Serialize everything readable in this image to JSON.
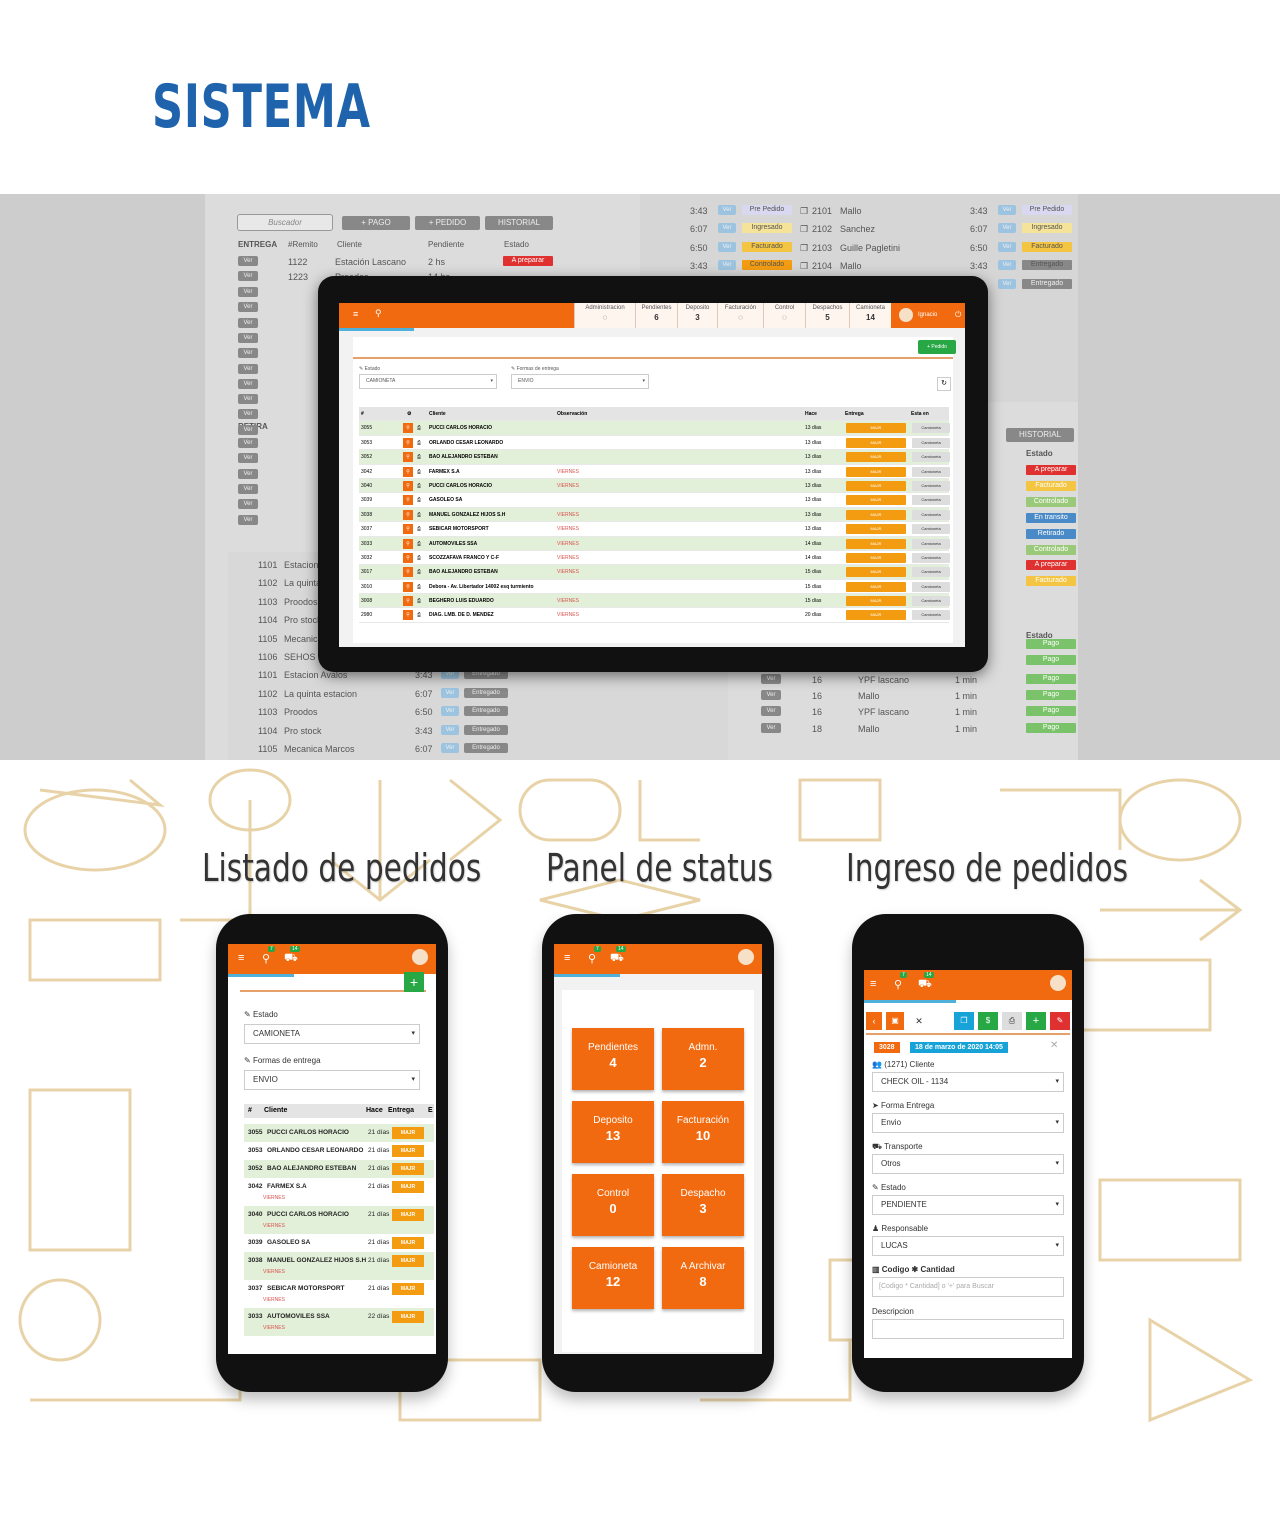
{
  "page": {
    "title": "SISTEMA",
    "sections": [
      {
        "label": "Listado de pedidos"
      },
      {
        "label": "Panel de status"
      },
      {
        "label": "Ingreso de pedidos"
      }
    ]
  },
  "colors": {
    "brand": "#1f63ad",
    "accent": "#f26a0f",
    "badge": "#f39c12",
    "row_green": "#e2f0d9"
  },
  "background_app": {
    "search_placeholder": "Buscador",
    "buttons": [
      "+ PAGO",
      "+ PEDIDO",
      "HISTORIAL"
    ],
    "headers": [
      "ENTREGA",
      "#Remito",
      "Cliente",
      "Pendiente",
      "Estado"
    ],
    "rows": [
      {
        "btn": "Ver",
        "num": "1122",
        "client": "Estación Lascano",
        "pend": "2 hs",
        "estado": "A preparar"
      },
      {
        "btn": "Ver",
        "num": "1223",
        "client": "Proodos",
        "pend": "14 hs",
        "estado": ""
      }
    ],
    "retira": "RETIRA",
    "list_items": [
      {
        "num": "1101",
        "name": "Estacion"
      },
      {
        "num": "1102",
        "name": "La quinta"
      },
      {
        "num": "1103",
        "name": "Proodos"
      },
      {
        "num": "1104",
        "name": "Pro stock"
      },
      {
        "num": "1105",
        "name": "Mecanica"
      },
      {
        "num": "1106",
        "name": "SEHOS"
      },
      {
        "num": "1101",
        "name": "Estacion Avalos",
        "time": "3:43",
        "status": "Entregado"
      },
      {
        "num": "1102",
        "name": "La quinta estacion",
        "time": "6:07",
        "status": "Entregado"
      },
      {
        "num": "1103",
        "name": "Proodos",
        "time": "6:50",
        "status": "Entregado"
      },
      {
        "num": "1104",
        "name": "Pro stock",
        "time": "3:43",
        "status": "Entregado"
      },
      {
        "num": "1105",
        "name": "Mecanica Marcos",
        "time": "6:07",
        "status": "Entregado"
      }
    ],
    "top_right": [
      {
        "time": "3:43",
        "status": "Pre Pedido",
        "num": "2101",
        "name": "Mallo",
        "time2": "3:43",
        "status2": "Pre Pedido"
      },
      {
        "time": "6:07",
        "status": "Ingresado",
        "num": "2102",
        "name": "Sanchez",
        "time2": "6:07",
        "status2": "Ingresado"
      },
      {
        "time": "6:50",
        "status": "Facturado",
        "num": "2103",
        "name": "Guille Pagletini",
        "time2": "6:50",
        "status2": "Facturado"
      },
      {
        "time": "3:43",
        "status": "Controlado",
        "num": "2104",
        "name": "Mallo",
        "time2": "3:43",
        "status2": "Entregado"
      }
    ],
    "right_estado": [
      "A preparar",
      "Facturado",
      "Controlado",
      "En transito",
      "Retirado",
      "Controlado",
      "A preparar",
      "Facturado",
      "Pago",
      "Pago"
    ],
    "bottom_right": [
      {
        "btn": "Ver",
        "n": "16",
        "client": "YPF lascano",
        "t": "1 min",
        "estado": "Pago"
      },
      {
        "btn": "Ver",
        "n": "16",
        "client": "Mallo",
        "t": "1 min",
        "estado": "Pago"
      },
      {
        "btn": "Ver",
        "n": "16",
        "client": "YPF lascano",
        "t": "1 min",
        "estado": "Pago"
      },
      {
        "btn": "Ver",
        "n": "18",
        "client": "Mallo",
        "t": "1 min",
        "estado": "Pago"
      }
    ]
  },
  "tablet": {
    "stats": [
      {
        "label": "Administracion",
        "value": ""
      },
      {
        "label": "Pendientes",
        "value": "6"
      },
      {
        "label": "Deposito",
        "value": "3"
      },
      {
        "label": "Facturación",
        "value": ""
      },
      {
        "label": "Control",
        "value": ""
      },
      {
        "label": "Despachos",
        "value": "5"
      },
      {
        "label": "Camioneta",
        "value": "14"
      }
    ],
    "user": "Ignacio",
    "new_button": "+ Pedido",
    "estado_label": "Estado",
    "estado_value": "CAMIONETA",
    "forma_label": "Formas de entrega",
    "forma_value": "ENVIO",
    "headers": [
      "#",
      "Cliente",
      "Observación",
      "Hace",
      "Entrega",
      "Esta en"
    ],
    "rows": [
      {
        "id": "3055",
        "client": "PUCCI CARLOS HORACIO",
        "obs": "",
        "hace": "13 días",
        "green": true
      },
      {
        "id": "3053",
        "client": "ORLANDO CESAR LEONARDO",
        "obs": "",
        "hace": "13 días",
        "green": false
      },
      {
        "id": "3052",
        "client": "BAO ALEJANDRO ESTEBAN",
        "obs": "",
        "hace": "13 días",
        "green": true
      },
      {
        "id": "3042",
        "client": "FARMEX S.A",
        "obs": "VIERNES",
        "hace": "13 días",
        "green": false
      },
      {
        "id": "3040",
        "client": "PUCCI CARLOS HORACIO",
        "obs": "VIERNES",
        "hace": "13 días",
        "green": true
      },
      {
        "id": "3039",
        "client": "GASOLEO SA",
        "obs": "",
        "hace": "13 días",
        "green": false
      },
      {
        "id": "3038",
        "client": "MANUEL GONZALEZ HIJOS S.H",
        "obs": "VIERNES",
        "hace": "13 días",
        "green": true
      },
      {
        "id": "3037",
        "client": "SEBICAR MOTORSPORT",
        "obs": "VIERNES",
        "hace": "13 días",
        "green": false
      },
      {
        "id": "3033",
        "client": "AUTOMOVILES SSA",
        "obs": "VIERNES",
        "hace": "14 días",
        "green": true
      },
      {
        "id": "3032",
        "client": "SCOZZAFAVA FRANCO Y C-F",
        "obs": "VIERNES",
        "hace": "14 días",
        "green": false
      },
      {
        "id": "3017",
        "client": "BAO ALEJANDRO ESTEBAN",
        "obs": "VIERNES",
        "hace": "15 días",
        "green": true
      },
      {
        "id": "3010",
        "client": "Debora - Av. Libertador 14002 esq turmiento",
        "obs": "",
        "hace": "15 días",
        "green": false
      },
      {
        "id": "3008",
        "client": "BEGHERO LUIS EDUARDO",
        "obs": "VIERNES",
        "hace": "15 días",
        "green": true
      },
      {
        "id": "2980",
        "client": "DIAG. LMB. DE D. MENDEZ",
        "obs": "VIERNES",
        "hace": "20 días",
        "green": false
      }
    ],
    "entrega_btn": "MAJR",
    "esta_btn": "Camioneta"
  },
  "phone1": {
    "badges": [
      "7",
      "14"
    ],
    "estado_label": "Estado",
    "estado_value": "CAMIONETA",
    "forma_label": "Formas de entrega",
    "forma_value": "ENVIO",
    "headers": [
      "#",
      "Cliente",
      "Hace",
      "Entrega",
      "E"
    ],
    "rows": [
      {
        "id": "3055",
        "client": "PUCCI CARLOS HORACIO",
        "hace": "21 días",
        "obs": ""
      },
      {
        "id": "3053",
        "client": "ORLANDO CESAR LEONARDO",
        "hace": "21 días",
        "obs": ""
      },
      {
        "id": "3052",
        "client": "BAO ALEJANDRO ESTEBAN",
        "hace": "21 días",
        "obs": ""
      },
      {
        "id": "3042",
        "client": "FARMEX S.A",
        "hace": "21 días",
        "obs": "VIERNES"
      },
      {
        "id": "3040",
        "client": "PUCCI CARLOS HORACIO",
        "hace": "21 días",
        "obs": "VIERNES"
      },
      {
        "id": "3039",
        "client": "GASOLEO SA",
        "hace": "21 días",
        "obs": ""
      },
      {
        "id": "3038",
        "client": "MANUEL GONZALEZ HIJOS S.H",
        "hace": "21 días",
        "obs": "VIERNES"
      },
      {
        "id": "3037",
        "client": "SEBICAR MOTORSPORT",
        "hace": "21 días",
        "obs": "VIERNES"
      },
      {
        "id": "3033",
        "client": "AUTOMOVILES SSA",
        "hace": "22 días",
        "obs": "VIERNES"
      }
    ],
    "majr": "MAJR"
  },
  "phone2": {
    "badges": [
      "7",
      "14"
    ],
    "tiles": [
      {
        "label": "Pendientes",
        "value": "4"
      },
      {
        "label": "Admn.",
        "value": "2"
      },
      {
        "label": "Deposito",
        "value": "13"
      },
      {
        "label": "Facturación",
        "value": "10"
      },
      {
        "label": "Control",
        "value": "0"
      },
      {
        "label": "Despacho",
        "value": "3"
      },
      {
        "label": "Camioneta",
        "value": "12"
      },
      {
        "label": "A Archivar",
        "value": "8"
      }
    ]
  },
  "phone3": {
    "badges": [
      "7",
      "14"
    ],
    "order_id": "3028",
    "date": "18 de marzo de 2020 14:05",
    "cliente_label": "(1271) Cliente",
    "cliente_value": "CHECK OIL - 1134",
    "forma_label": "Forma Entrega",
    "forma_value": "Envio",
    "transporte_label": "Transporte",
    "transporte_value": "Otros",
    "estado_label": "Estado",
    "estado_value": "PENDIENTE",
    "responsable_label": "Responsable",
    "responsable_value": "LUCAS",
    "codigo_label": "Codigo ✱ Cantidad",
    "codigo_placeholder": "[Codigo * Cantidad] o '+' para Buscar",
    "descripcion_label": "Descripcion"
  }
}
